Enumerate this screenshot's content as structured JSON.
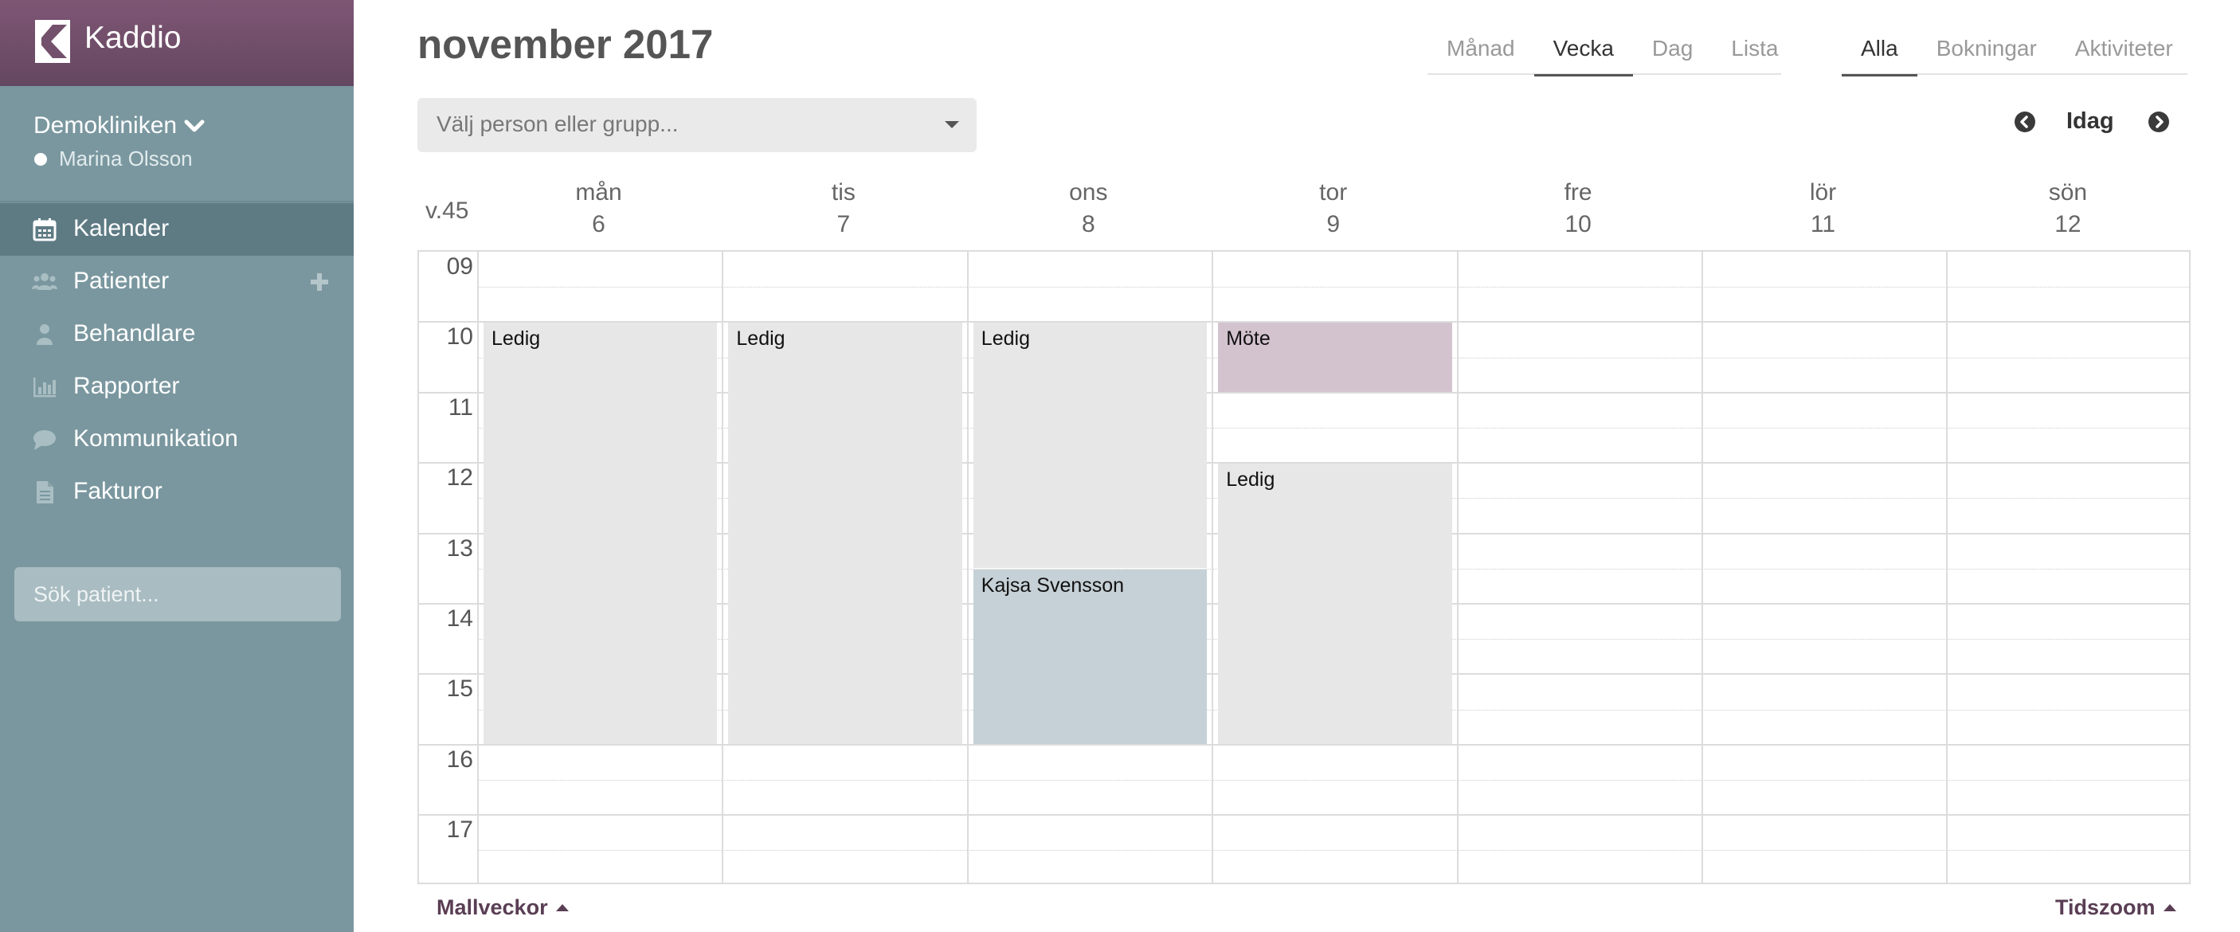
{
  "app": {
    "name": "Kaddio"
  },
  "sidebar": {
    "clinic": "Demokliniken",
    "user": "Marina Olsson",
    "items": [
      {
        "label": "Kalender",
        "icon": "calendar-icon",
        "active": true
      },
      {
        "label": "Patienter",
        "icon": "users-icon",
        "active": false
      },
      {
        "label": "Behandlare",
        "icon": "user-icon",
        "active": false
      },
      {
        "label": "Rapporter",
        "icon": "bar-chart-icon",
        "active": false
      },
      {
        "label": "Kommunikation",
        "icon": "chat-bubble-icon",
        "active": false
      },
      {
        "label": "Fakturor",
        "icon": "document-icon",
        "active": false
      }
    ],
    "search_placeholder": "Sök patient..."
  },
  "header": {
    "title": "november 2017",
    "view_tabs": [
      "Månad",
      "Vecka",
      "Dag",
      "Lista"
    ],
    "active_view": "Vecka",
    "filter_tabs": [
      "Alla",
      "Bokningar",
      "Aktiviteter"
    ],
    "active_filter": "Alla",
    "person_select_placeholder": "Välj person eller grupp...",
    "today_label": "Idag"
  },
  "calendar": {
    "week_label": "v.45",
    "days": [
      {
        "name": "mån",
        "date": "6"
      },
      {
        "name": "tis",
        "date": "7"
      },
      {
        "name": "ons",
        "date": "8"
      },
      {
        "name": "tor",
        "date": "9"
      },
      {
        "name": "fre",
        "date": "10"
      },
      {
        "name": "lör",
        "date": "11"
      },
      {
        "name": "sön",
        "date": "12"
      }
    ],
    "hours": [
      "09",
      "10",
      "11",
      "12",
      "13",
      "14",
      "15",
      "16",
      "17"
    ],
    "events": [
      {
        "day": 0,
        "start": 10,
        "end": 16,
        "title": "Ledig",
        "kind": "free"
      },
      {
        "day": 1,
        "start": 10,
        "end": 16,
        "title": "Ledig",
        "kind": "free"
      },
      {
        "day": 2,
        "start": 10,
        "end": 13.5,
        "title": "Ledig",
        "kind": "free"
      },
      {
        "day": 2,
        "start": 13.5,
        "end": 16,
        "title": "Kajsa Svensson",
        "kind": "booking"
      },
      {
        "day": 3,
        "start": 10,
        "end": 11,
        "title": "Möte",
        "kind": "meeting"
      },
      {
        "day": 3,
        "start": 12,
        "end": 16,
        "title": "Ledig",
        "kind": "free"
      }
    ]
  },
  "footer": {
    "template_weeks": "Mallveckor",
    "time_zoom": "Tidszoom"
  },
  "colors": {
    "brand": "#7e5675",
    "sidebar": "#7a979f",
    "free": "#e7e7e7",
    "meeting": "#d3c3cf",
    "booking": "#c6d1d7"
  }
}
